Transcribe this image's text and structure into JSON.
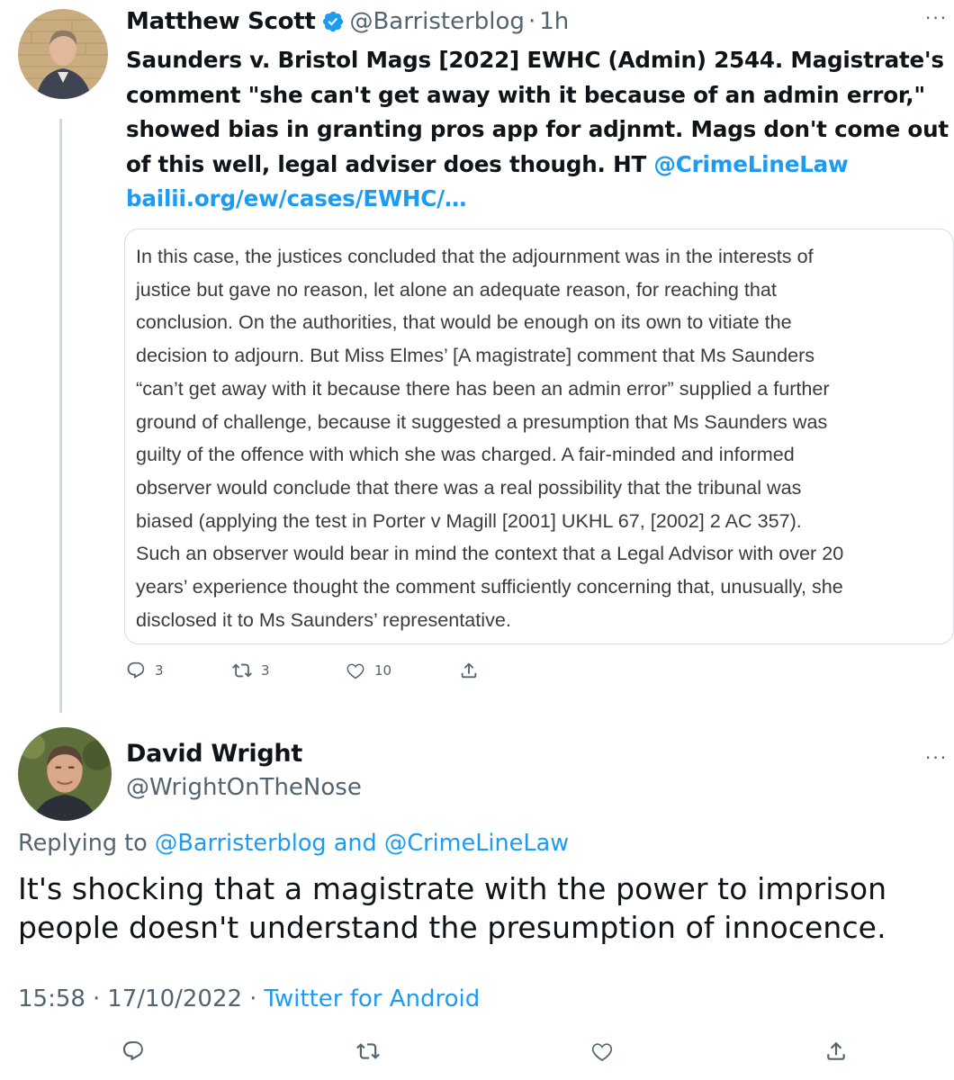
{
  "tweet1": {
    "author_name": "Matthew Scott",
    "handle": "@Barristerblog",
    "dot": "·",
    "time": "1h",
    "text_lines": [
      "Saunders v. Bristol Mags [2022] EWHC (Admin) 2544. Magistrate's",
      "comment \"she can't get away with it because of an admin error,\"",
      "showed bias in granting pros app for adjnmt. Mags don't come out",
      "of this well, legal adviser does though. HT "
    ],
    "mention": "@CrimeLineLaw",
    "link": "bailii.org/ew/cases/EWHC/…",
    "quote_lines": [
      "In this case, the justices concluded that the adjournment was in the interests of",
      "justice but gave no reason, let alone an adequate reason, for reaching that",
      "conclusion. On the authorities, that would be enough on its own to vitiate the",
      "decision to adjourn. But Miss Elmes’ [A magistrate] comment that Ms Saunders",
      "“can’t get away with it because there has been an admin error” supplied a further",
      "ground of challenge, because it suggested a presumption that Ms Saunders was",
      "guilty of the offence with which she was charged. A fair-minded and informed",
      "observer would conclude that there was a real possibility that the tribunal was",
      "biased (applying the test in Porter v Magill [2001] UKHL 67, [2002] 2 AC 357).",
      "Such an observer would bear in mind the context that a Legal Advisor with over 20",
      "years’ experience thought the comment sufficiently concerning that, unusually, she",
      "disclosed it to Ms Saunders’ representative."
    ],
    "replies": "3",
    "retweets": "3",
    "likes": "10"
  },
  "tweet2": {
    "author_name": "David Wright",
    "handle": "@WrightOnTheNose",
    "replying_prefix": "Replying to ",
    "replying_to_1": "@Barristerblog",
    "replying_and": " and ",
    "replying_to_2": "@CrimeLineLaw",
    "text_lines": [
      "It's shocking that a magistrate with the power to imprison",
      "people doesn't understand the presumption of innocence."
    ],
    "time": "15:58",
    "separator": "·",
    "date": "17/10/2022",
    "source": "Twitter for Android"
  },
  "icons": [
    "verified-badge-icon",
    "more-icon",
    "reply-icon",
    "retweet-icon",
    "like-icon",
    "share-icon"
  ],
  "colors": {
    "accent": "#1d9bf0",
    "secondary_text": "#536471",
    "primary_text": "#0f1419",
    "thread_line": "#cfd9de"
  }
}
